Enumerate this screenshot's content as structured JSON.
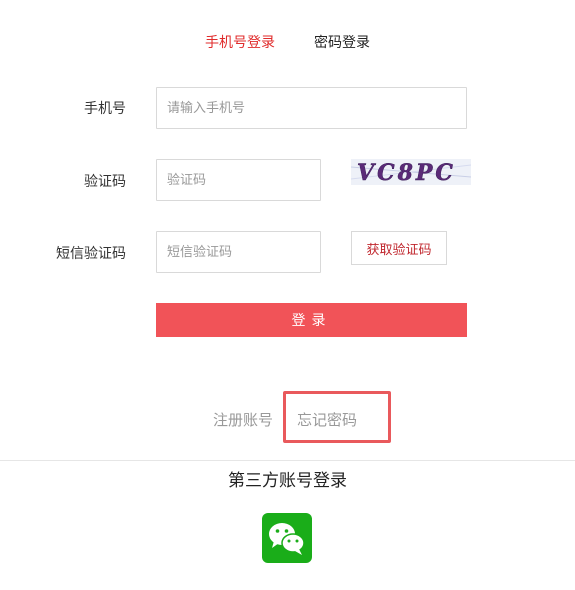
{
  "tabs": {
    "phone_login": "手机号登录",
    "password_login": "密码登录"
  },
  "form": {
    "phone_label": "手机号",
    "phone_placeholder": "请输入手机号",
    "captcha_label": "验证码",
    "captcha_placeholder": "验证码",
    "captcha_text": "VC8PC",
    "sms_label": "短信验证码",
    "sms_placeholder": "短信验证码",
    "get_sms_button": "获取验证码",
    "login_button": "登录"
  },
  "links": {
    "register": "注册账号",
    "forgot_password": "忘记密码"
  },
  "third_party": {
    "title": "第三方账号登录",
    "icons": [
      "wechat-icon"
    ]
  },
  "colors": {
    "accent": "#e02b2b",
    "login_button": "#f15358",
    "highlight_border": "#e9595c",
    "wechat_green": "#1aad19"
  }
}
